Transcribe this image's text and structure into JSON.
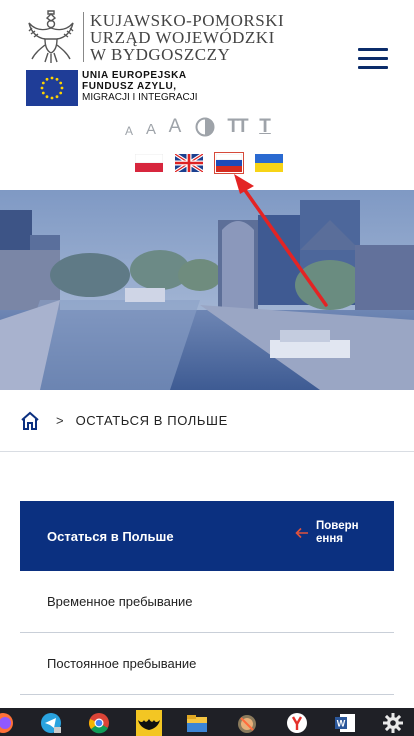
{
  "header": {
    "office_name_lines": [
      "KUJAWSKO-POMORSKI",
      "URZĄD WOJEWÓDZKI",
      "W BYDGOSZCZY"
    ],
    "eu_lines": [
      "UNIA EUROPEJSKA",
      "FUNDUSZ AZYLU,",
      "MIGRACJI I INTEGRACJI"
    ],
    "accessibility": {
      "a_small": "A",
      "a_medium": "A",
      "a_large": "A",
      "text_increase": "TT",
      "text_reset": "T"
    },
    "languages": [
      "Polski",
      "English",
      "Русский",
      "Українська"
    ],
    "active_language": "Русский"
  },
  "breadcrumb": {
    "separator": ">",
    "current": "ОСТАТЬСЯ В ПОЛЬШЕ"
  },
  "panel": {
    "title": "Остаться в Польше",
    "back_label": "Поверн ення"
  },
  "menu_items": [
    "Временное пребывание",
    "Постоянное пребывание"
  ],
  "colors": {
    "navy": "#0b3080",
    "hamburger": "#0b2c6a",
    "annotation_red": "#e32424",
    "taskbar": "#1f2026"
  },
  "taskbar_icons": [
    "firefox-icon",
    "telegram-icon",
    "chrome-icon",
    "batman-icon",
    "file-explorer-icon",
    "gimp-icon",
    "yandex-browser-icon",
    "word-icon",
    "settings-gear-icon"
  ]
}
